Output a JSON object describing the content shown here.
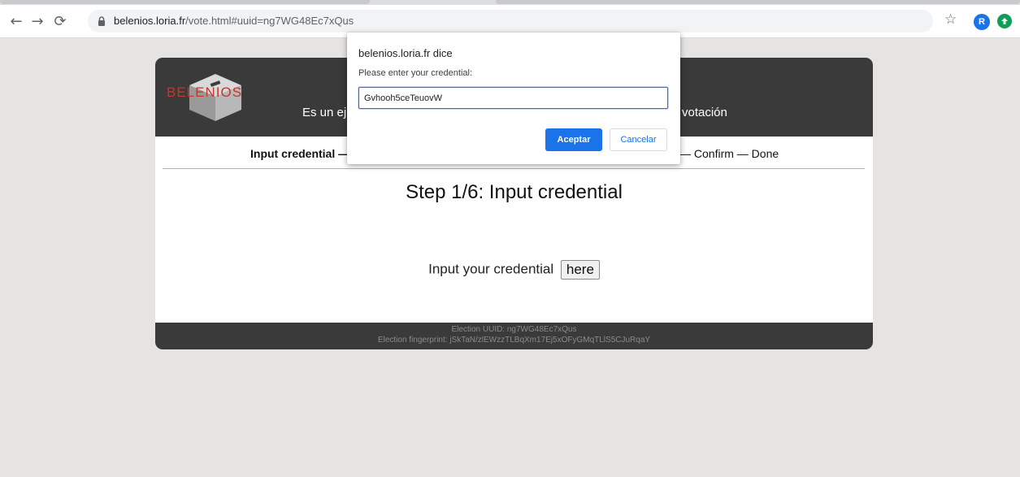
{
  "browser": {
    "url_host": "belenios.loria.fr",
    "url_path": "/vote.html#uuid=ng7WG48Ec7xQus",
    "avatar_letter": "R",
    "icons": [
      "back-arrow-icon",
      "forward-arrow-icon",
      "reload-icon",
      "lock-icon",
      "bookmark-star-icon",
      "profile-avatar-icon",
      "extension-icon"
    ]
  },
  "page": {
    "logo_text": "BELENIOS",
    "header_left": "Es un eje",
    "header_right": "votación",
    "steps_left": "Input credential —",
    "steps_right": "— Confirm — Done",
    "step_title": "Step 1/6: Input credential",
    "input_prompt": "Input your credential",
    "here_button": "here",
    "footer_uuid": "Election UUID: ng7WG48Ec7xQus",
    "footer_fingerprint": "Election fingerprint: jSkTaN/zlEWzzTLBqXm17Ej5xOFyGMqTLlS5CJuRqaY"
  },
  "dialog": {
    "title": "belenios.loria.fr dice",
    "message": "Please enter your credential:",
    "input_value": "Gvhooh5ceTeuovW",
    "accept_label": "Aceptar",
    "cancel_label": "Cancelar"
  },
  "colors": {
    "accent": "#1a73e8",
    "header_bg": "#3a3a3a",
    "page_bg": "#e5e4e2",
    "logo_red": "#c0392b"
  }
}
